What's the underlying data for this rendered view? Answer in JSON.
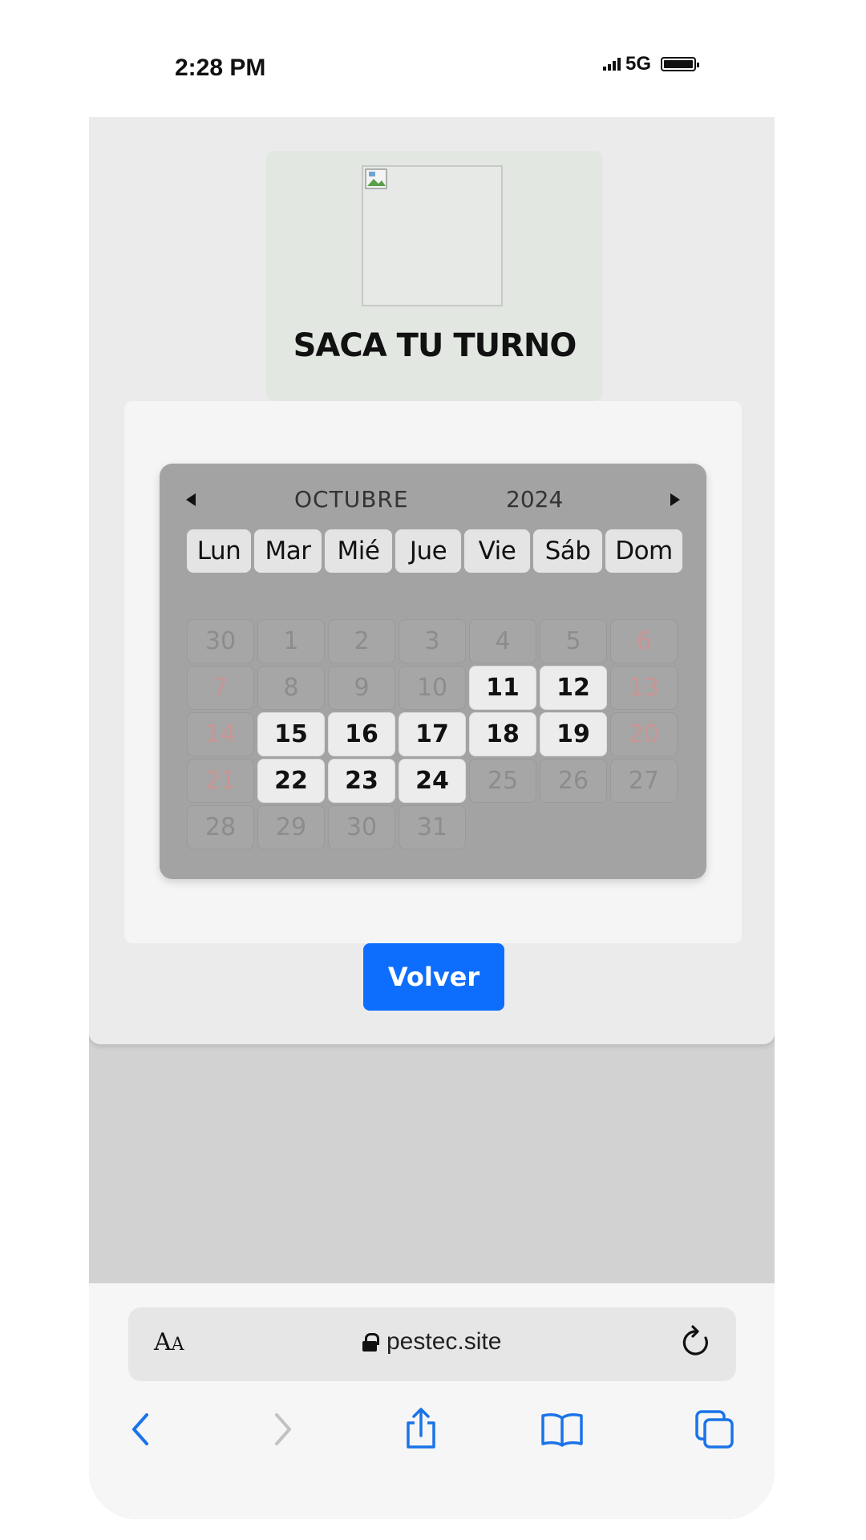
{
  "status": {
    "time": "2:28 PM",
    "network": "5G"
  },
  "header": {
    "title": "SACA TU TURNO"
  },
  "calendar": {
    "month": "OCTUBRE",
    "year": "2024",
    "weekdays": [
      "Lun",
      "Mar",
      "Mié",
      "Jue",
      "Vie",
      "Sáb",
      "Dom"
    ],
    "days": [
      {
        "label": "30",
        "state": "disabled"
      },
      {
        "label": "1",
        "state": "disabled"
      },
      {
        "label": "2",
        "state": "disabled"
      },
      {
        "label": "3",
        "state": "disabled"
      },
      {
        "label": "4",
        "state": "disabled"
      },
      {
        "label": "5",
        "state": "disabled"
      },
      {
        "label": "6",
        "state": "weekend"
      },
      {
        "label": "7",
        "state": "weekend"
      },
      {
        "label": "8",
        "state": "disabled"
      },
      {
        "label": "9",
        "state": "disabled"
      },
      {
        "label": "10",
        "state": "disabled"
      },
      {
        "label": "11",
        "state": "available"
      },
      {
        "label": "12",
        "state": "available"
      },
      {
        "label": "13",
        "state": "weekend"
      },
      {
        "label": "14",
        "state": "weekend"
      },
      {
        "label": "15",
        "state": "available"
      },
      {
        "label": "16",
        "state": "available"
      },
      {
        "label": "17",
        "state": "available"
      },
      {
        "label": "18",
        "state": "available"
      },
      {
        "label": "19",
        "state": "available"
      },
      {
        "label": "20",
        "state": "weekend"
      },
      {
        "label": "21",
        "state": "weekend"
      },
      {
        "label": "22",
        "state": "available"
      },
      {
        "label": "23",
        "state": "available"
      },
      {
        "label": "24",
        "state": "available"
      },
      {
        "label": "25",
        "state": "disabled"
      },
      {
        "label": "26",
        "state": "disabled"
      },
      {
        "label": "27",
        "state": "disabled"
      },
      {
        "label": "28",
        "state": "disabled"
      },
      {
        "label": "29",
        "state": "disabled"
      },
      {
        "label": "30",
        "state": "disabled"
      },
      {
        "label": "31",
        "state": "disabled"
      }
    ]
  },
  "actions": {
    "back_label": "Volver"
  },
  "browser": {
    "aa_big": "A",
    "aa_small": "A",
    "url": "pestec.site"
  },
  "colors": {
    "primary": "#0d6efd",
    "calendar_bg": "#a3a3a3",
    "weekend_text": "#c99595"
  }
}
